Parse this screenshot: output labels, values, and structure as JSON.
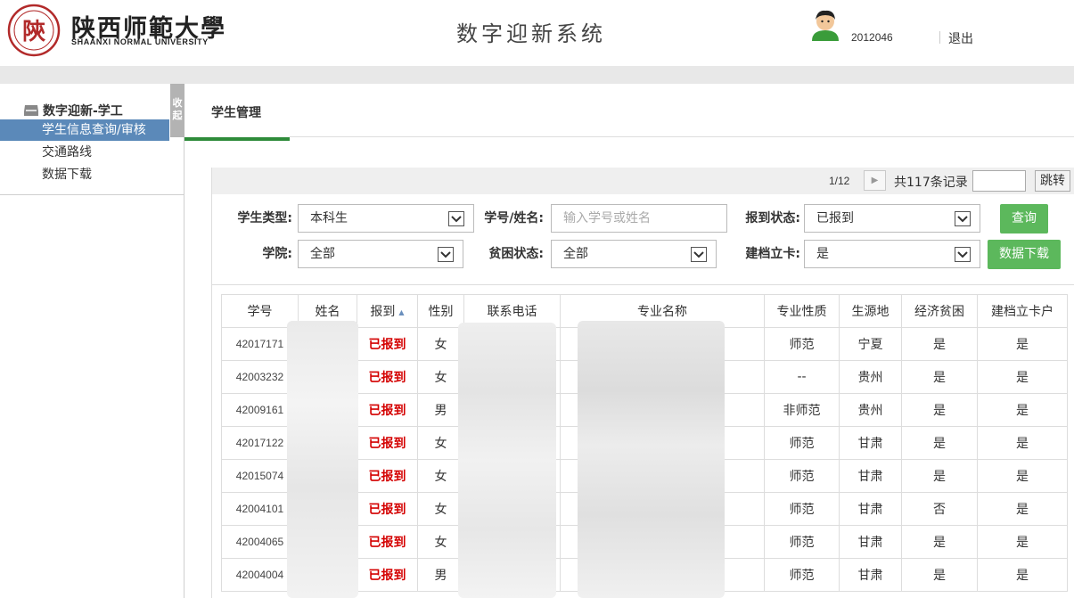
{
  "header": {
    "logo_seal_text": "陝",
    "logo_cn": "陕西师範大學",
    "logo_en": "SHAANXI NORMAL UNIVERSITY",
    "app_title": "数字迎新系统",
    "user_id": "2012046",
    "logout_label": "退出"
  },
  "sidebar": {
    "section_title": "数字迎新-学工",
    "collapse_label": "收起",
    "items": [
      {
        "label": "学生信息查询/审核",
        "active": true
      },
      {
        "label": "交通路线",
        "active": false
      },
      {
        "label": "数据下载",
        "active": false
      }
    ]
  },
  "main": {
    "tab_label": "学生管理",
    "pager": {
      "page": "1/12",
      "next_icon": "triangle-right-icon",
      "total": "共117条记录",
      "jump_label": "跳转"
    },
    "filters": {
      "student_type_label": "学生类型:",
      "student_type_value": "本科生",
      "id_name_label": "学号/姓名:",
      "id_name_placeholder": "输入学号或姓名",
      "report_status_label": "报到状态:",
      "report_status_value": "已报到",
      "query_button": "查询",
      "college_label": "学院:",
      "college_value": "全部",
      "poverty_label": "贫困状态:",
      "poverty_value": "全部",
      "archive_label": "建档立卡:",
      "archive_value": "是",
      "download_button": "数据下载"
    },
    "table": {
      "columns": [
        "学号",
        "姓名",
        "报到",
        "性别",
        "联系电话",
        "专业名称",
        "专业性质",
        "生源地",
        "经济贫困",
        "建档立卡户"
      ],
      "rows": [
        {
          "id": "42017171",
          "status": "已报到",
          "gender": "女",
          "nature": "师范",
          "origin": "宁夏",
          "poor": "是",
          "archived": "是"
        },
        {
          "id": "42003232",
          "status": "已报到",
          "gender": "女",
          "nature": "--",
          "origin": "贵州",
          "poor": "是",
          "archived": "是"
        },
        {
          "id": "42009161",
          "status": "已报到",
          "gender": "男",
          "nature": "非师范",
          "origin": "贵州",
          "poor": "是",
          "archived": "是"
        },
        {
          "id": "42017122",
          "status": "已报到",
          "gender": "女",
          "nature": "师范",
          "origin": "甘肃",
          "poor": "是",
          "archived": "是"
        },
        {
          "id": "42015074",
          "status": "已报到",
          "gender": "女",
          "nature": "师范",
          "origin": "甘肃",
          "poor": "是",
          "archived": "是"
        },
        {
          "id": "42004101",
          "status": "已报到",
          "gender": "女",
          "nature": "师范",
          "origin": "甘肃",
          "poor": "否",
          "archived": "是"
        },
        {
          "id": "42004065",
          "status": "已报到",
          "gender": "女",
          "nature": "师范",
          "origin": "甘肃",
          "poor": "是",
          "archived": "是"
        },
        {
          "id": "42004004",
          "status": "已报到",
          "gender": "男",
          "nature": "师范",
          "origin": "甘肃",
          "poor": "是",
          "archived": "是"
        }
      ]
    }
  },
  "colors": {
    "active_nav": "#5b89b9",
    "tab_underline": "#2e8b3a",
    "button_green": "#5cb85c",
    "status_red": "#d40000"
  }
}
